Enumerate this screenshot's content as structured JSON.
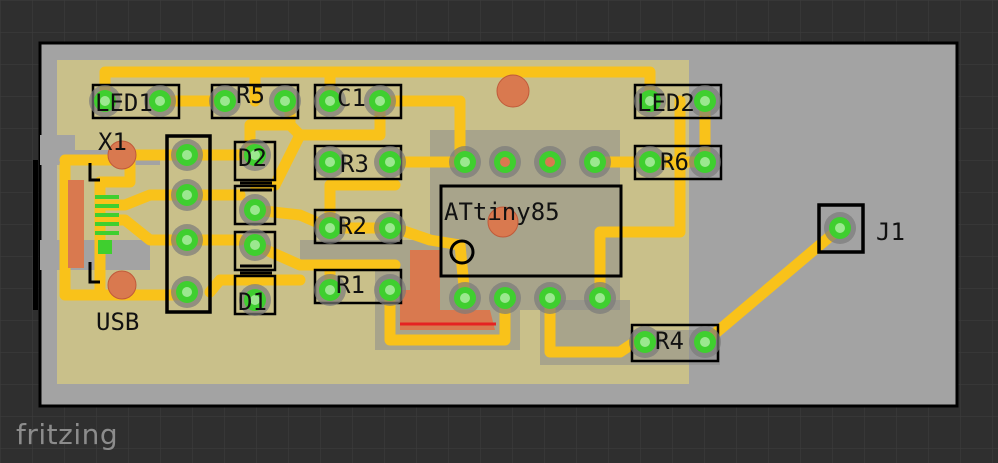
{
  "app": {
    "watermark": "fritzing"
  },
  "colors": {
    "background": "#2f2f2f",
    "grid": "#3a3a3a",
    "board": "#a3a3a3",
    "board_outline": "#000000",
    "copper_fill": "#c9c08a",
    "trace": "#f9c21a",
    "pad": "#3fcf2f",
    "pad_ring": "#7a7a7a",
    "smd_pad": "#d9794f",
    "silk": "#000000"
  },
  "labels": {
    "led1": "LED1",
    "r5": "R5",
    "c1": "C1",
    "led2": "LED2",
    "x1": "X1",
    "d2": "D2",
    "r3": "R3",
    "r6": "R6",
    "r2": "R2",
    "attiny": "ATtiny85",
    "j1": "J1",
    "r1": "R1",
    "d1": "D1",
    "usb": "USB",
    "r4": "R4"
  },
  "icons": {
    "ic_pin1_marker": "circle-outline-icon",
    "pad": "via-pad-icon"
  }
}
